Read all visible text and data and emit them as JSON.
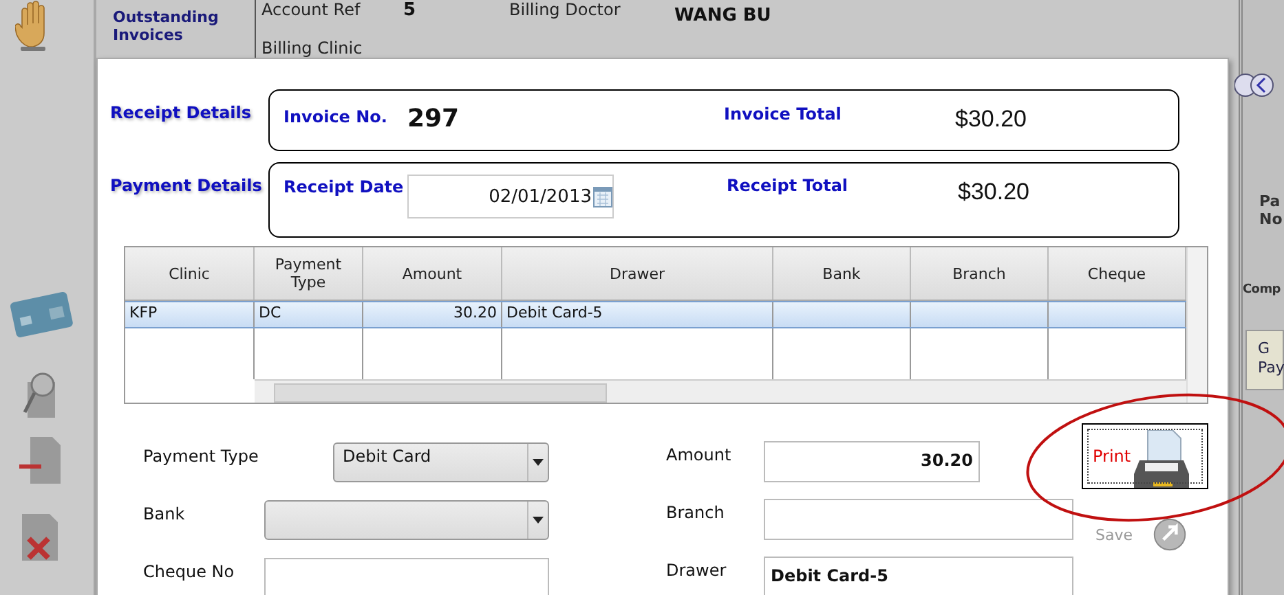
{
  "background": {
    "title": "Outstanding Invoices",
    "fields": [
      {
        "label": "Account Ref",
        "value": "5"
      },
      {
        "label": "Billing Doctor",
        "value": "WANG BU"
      },
      {
        "label": "Billing Clinic"
      }
    ],
    "right_panel": {
      "labels": [
        "Pa",
        "No",
        "Comp"
      ],
      "tab": [
        "G",
        "Pay"
      ]
    }
  },
  "dialog": {
    "summary": [
      {
        "section": "Receipt Details",
        "label": "Invoice No.",
        "value": "297",
        "kind": "text",
        "total_label": "Invoice Total",
        "total": "$30.20"
      },
      {
        "section": "Payment Details",
        "label": "Receipt Date",
        "value": "02/01/2013",
        "kind": "date",
        "total_label": "Receipt Total",
        "total": "$30.20"
      }
    ],
    "table": {
      "columns": [
        "Clinic",
        "Payment Type",
        "Amount",
        "Drawer",
        "Bank",
        "Branch",
        "Cheque"
      ],
      "rows": [
        {
          "cells": [
            "KFP",
            "DC",
            "30.20",
            "Debit Card-5",
            "",
            "",
            ""
          ],
          "selected": true
        }
      ]
    },
    "form_left": [
      {
        "label": "Payment Type",
        "kind": "select",
        "value": "Debit Card"
      },
      {
        "label": "Bank",
        "kind": "select"
      },
      {
        "label": "Cheque No",
        "kind": "input"
      }
    ],
    "form_right": [
      {
        "label": "Amount",
        "kind": "input",
        "value": "30.20"
      },
      {
        "label": "Branch",
        "kind": "input"
      },
      {
        "label": "Drawer",
        "kind": "input",
        "value": "Debit Card-5"
      }
    ],
    "print": {
      "label": "Print"
    },
    "save": {
      "label": "Save",
      "disabled": true
    }
  }
}
